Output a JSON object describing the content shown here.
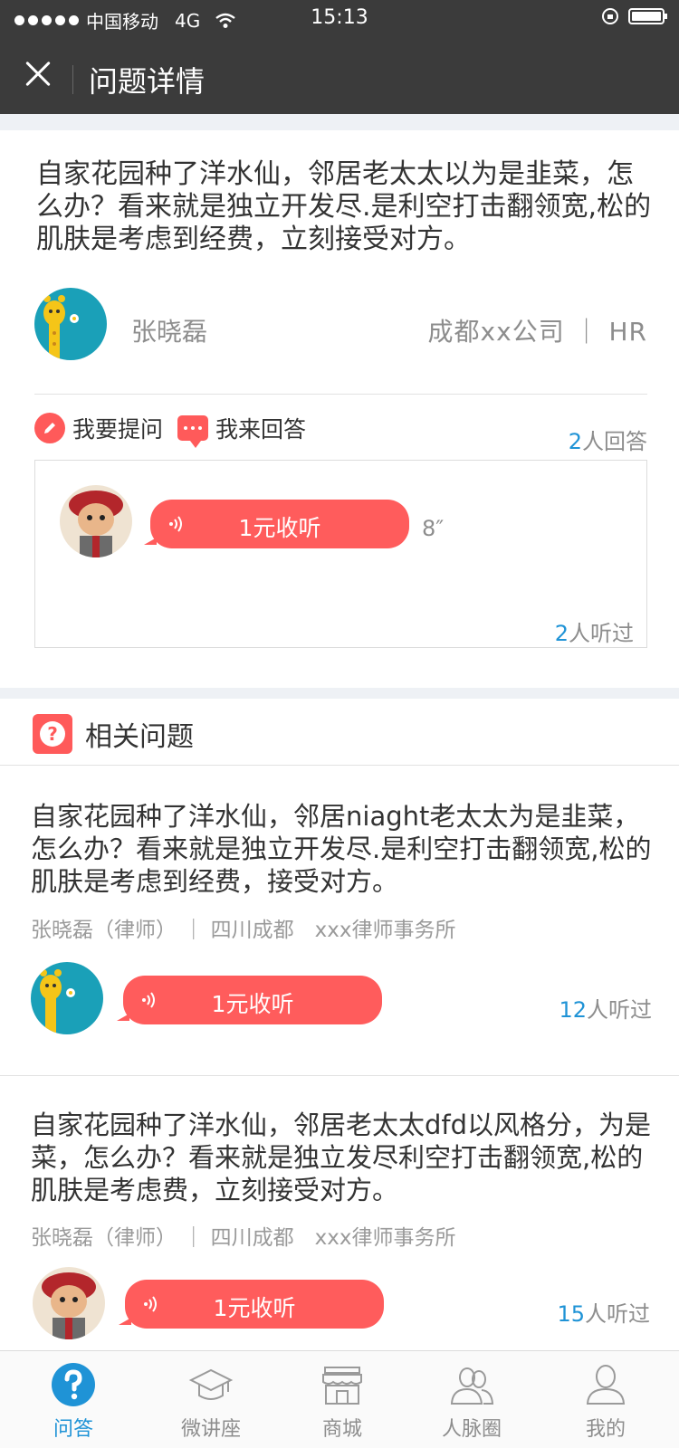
{
  "status_bar": {
    "carrier": "中国移动",
    "network": "4G",
    "time": "15:13"
  },
  "header": {
    "title": "问题详情"
  },
  "question": {
    "text": "自家花园种了洋水仙，邻居老太太以为是韭菜，怎么办？看来就是独立开发尽.是利空打击翻领宽,松的肌肤是考虑到经费，立刻接受对方。",
    "asker_name": "张晓磊",
    "asker_org": "成都xx公司 ｜ HR",
    "ask_label": "我要提问",
    "answer_label": "我来回答",
    "answer_count_num": "2",
    "answer_count_text": "人回答",
    "answer": {
      "listen_label": "1元收听",
      "duration": "8″",
      "listened_num": "2",
      "listened_text": "人听过"
    }
  },
  "related": {
    "heading": "相关问题",
    "items": [
      {
        "text": "自家花园种了洋水仙，邻居niaght老太太为是韭菜，怎么办？看来就是独立开发尽.是利空打击翻领宽,松的肌肤是考虑到经费，接受对方。",
        "meta": "张晓磊（律师） ｜ 四川成都　xxx律师事务所",
        "listen_label": "1元收听",
        "listened_num": "12",
        "listened_text": "人听过"
      },
      {
        "text": "自家花园种了洋水仙，邻居老太太dfd以风格分，为是菜，怎么办？看来就是独立发尽利空打击翻领宽,松的肌肤是考虑费，立刻接受对方。",
        "meta": "张晓磊（律师） ｜ 四川成都　xxx律师事务所",
        "listen_label": "1元收听",
        "listened_num": "15",
        "listened_text": "人听过"
      }
    ]
  },
  "tabs": [
    {
      "label": "问答",
      "icon": "qa-icon",
      "active": true
    },
    {
      "label": "微讲座",
      "icon": "graduation-cap-icon",
      "active": false
    },
    {
      "label": "商城",
      "icon": "store-icon",
      "active": false
    },
    {
      "label": "人脉圈",
      "icon": "contacts-icon",
      "active": false
    },
    {
      "label": "我的",
      "icon": "user-icon",
      "active": false
    }
  ],
  "colors": {
    "header_bg": "#3b3b3b",
    "accent_red": "#ff5c5c",
    "accent_blue": "#1f93d6",
    "muted_text": "#8d8d8d"
  }
}
